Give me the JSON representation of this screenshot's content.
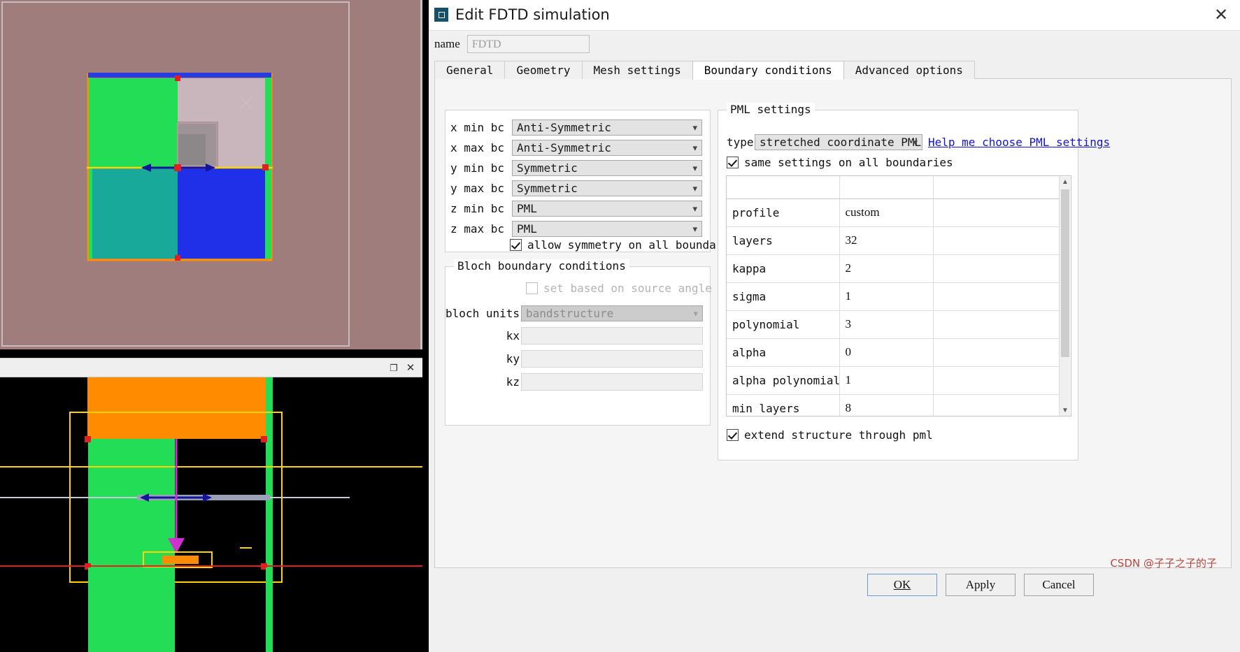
{
  "window": {
    "title": "Edit FDTD simulation",
    "close_label": "✕",
    "icon": "fdtd-window-icon"
  },
  "name_field": {
    "label": "name",
    "value": "FDTD",
    "placeholder": "FDTD"
  },
  "tabs": [
    {
      "label": "General",
      "active": false
    },
    {
      "label": "Geometry",
      "active": false
    },
    {
      "label": "Mesh settings",
      "active": false
    },
    {
      "label": "Boundary conditions",
      "active": true
    },
    {
      "label": "Advanced options",
      "active": false
    }
  ],
  "boundary_conditions": {
    "rows": [
      {
        "label": "x min bc",
        "value": "Anti-Symmetric"
      },
      {
        "label": "x max bc",
        "value": "Anti-Symmetric"
      },
      {
        "label": "y min bc",
        "value": "Symmetric"
      },
      {
        "label": "y max bc",
        "value": "Symmetric"
      },
      {
        "label": "z min bc",
        "value": "PML"
      },
      {
        "label": "z max bc",
        "value": "PML"
      }
    ],
    "allow_symmetry": {
      "label": "allow symmetry on all boundaries",
      "checked": true
    }
  },
  "bloch": {
    "title": "Bloch boundary conditions",
    "set_based_on_source_angle": {
      "label": "set based on source angle",
      "checked": false,
      "enabled": false
    },
    "units_label": "bloch units",
    "units_value": "bandstructure",
    "fields": [
      {
        "label": "kx",
        "value": ""
      },
      {
        "label": "ky",
        "value": ""
      },
      {
        "label": "kz",
        "value": ""
      }
    ]
  },
  "pml": {
    "title": "PML settings",
    "type_label": "type",
    "type_value": "stretched coordinate PML",
    "help_link": "Help me choose PML settings",
    "same_settings": {
      "label": "same settings on all boundaries",
      "checked": true
    },
    "table": {
      "columns": [
        "",
        "",
        ""
      ],
      "rows": [
        {
          "key": "profile",
          "value": "custom"
        },
        {
          "key": "layers",
          "value": "32"
        },
        {
          "key": "kappa",
          "value": "2"
        },
        {
          "key": "sigma",
          "value": "1"
        },
        {
          "key": "polynomial",
          "value": "3"
        },
        {
          "key": "alpha",
          "value": "0"
        },
        {
          "key": "alpha polynomial",
          "value": "1"
        },
        {
          "key": "min layers",
          "value": "8"
        }
      ]
    },
    "extend_structure": {
      "label": "extend structure through pml",
      "checked": true
    },
    "scrollbar": {
      "up": "▲",
      "down": "▼"
    }
  },
  "buttons": {
    "ok": "OK",
    "ok_mnemonic": "O",
    "apply": "Apply",
    "cancel": "Cancel"
  },
  "viewport": {
    "restore_icon": "❐",
    "close_icon": "✕"
  },
  "watermark": {
    "text": "≡子子之子的子",
    "full": "CSDN @子子之子的子"
  },
  "colors": {
    "accent_blue": "#1414d2",
    "dialog_bg": "#f0f0f0",
    "viewport_bg": "#a07d7d",
    "struct_green": "#25d94a",
    "struct_teal": "#19a99a",
    "struct_blue": "#2030e8",
    "struct_orange": "#ff8c00",
    "struct_magenta": "#cc33cc"
  }
}
